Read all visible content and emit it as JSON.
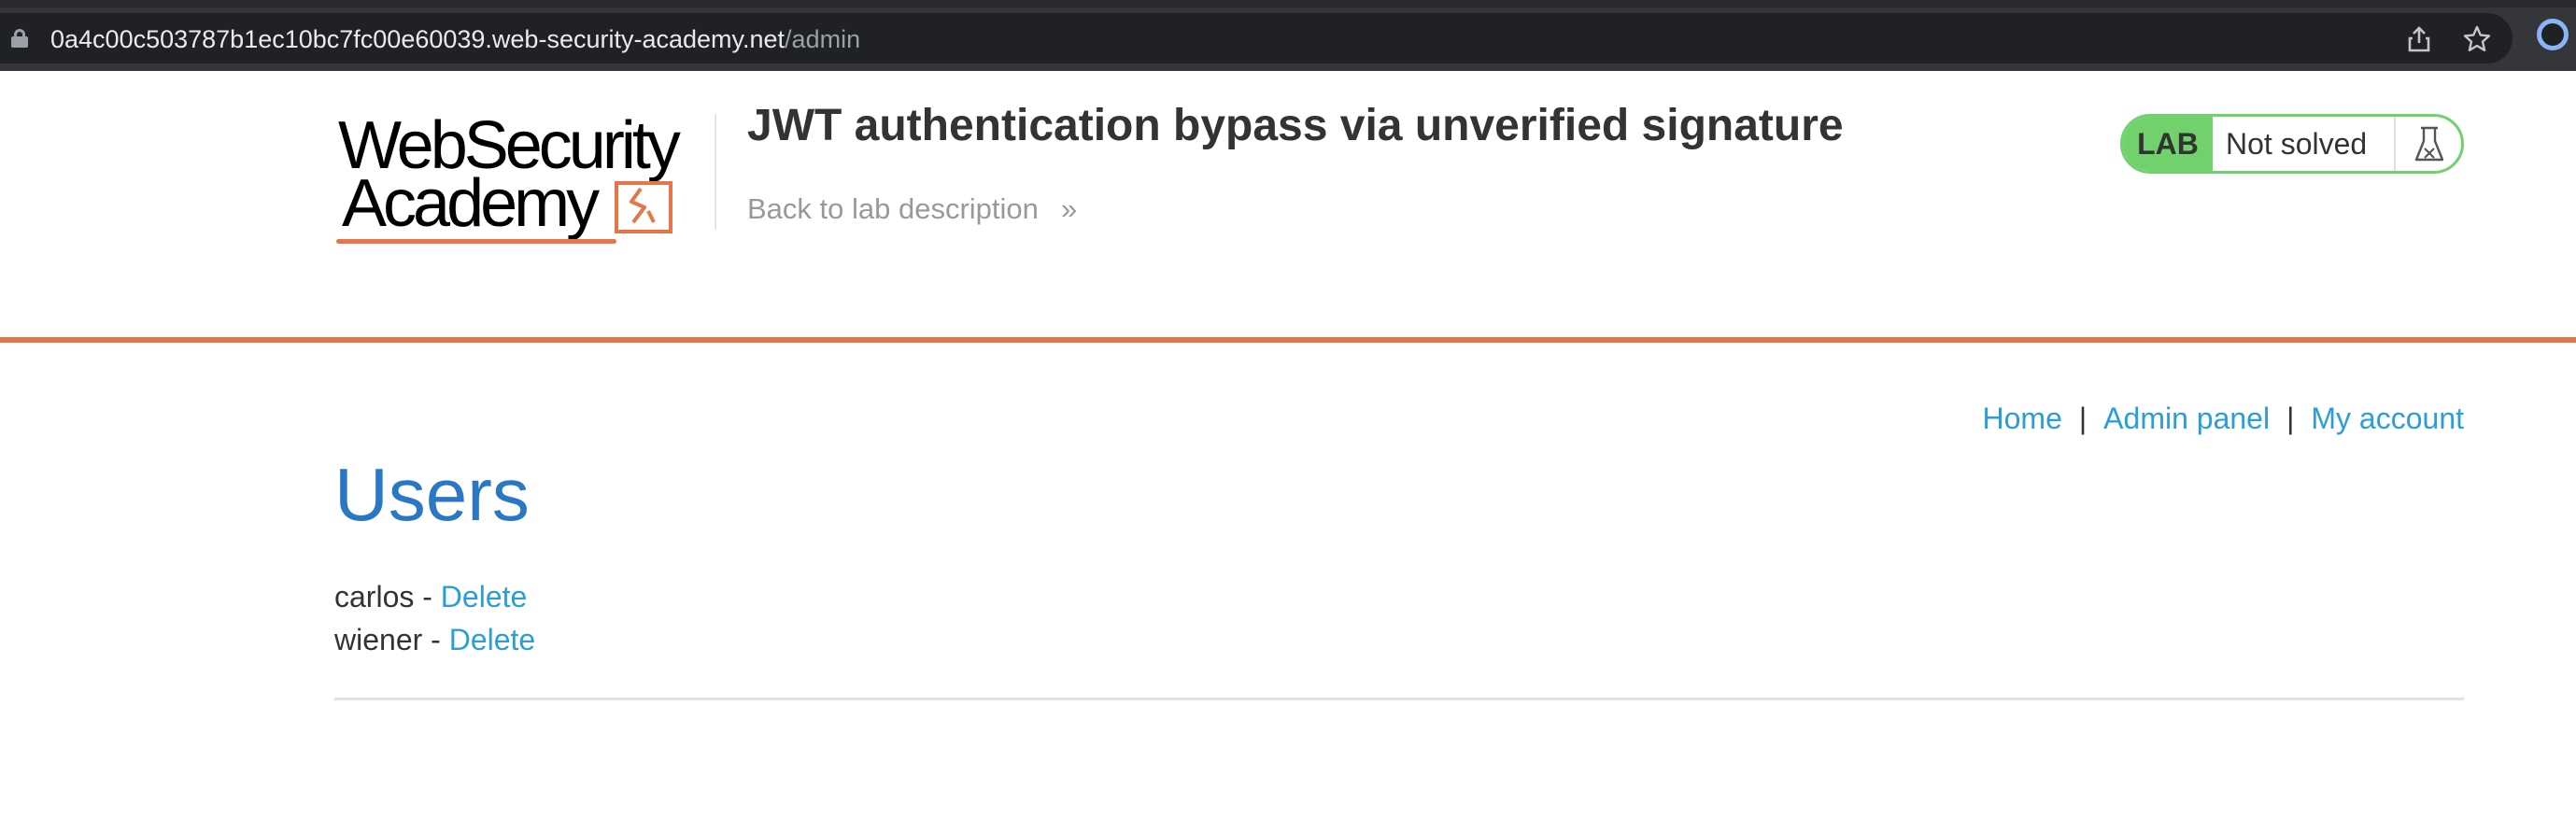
{
  "browser": {
    "url_host": "0a4c00c503787b1ec10bc7fc00e60039.web-security-academy.net",
    "url_path": "/admin",
    "icons": [
      "lock-icon",
      "share-icon",
      "star-icon",
      "profile-icon"
    ]
  },
  "header": {
    "logo_line1": "WebSecurity",
    "logo_line2": "Academy",
    "lab_title": "JWT authentication bypass via unverified signature",
    "back_link": "Back to lab description",
    "back_chevron": "»",
    "lab_badge": {
      "tag": "LAB",
      "status": "Not solved"
    }
  },
  "nav": {
    "home": "Home",
    "separator": "|",
    "admin_panel": "Admin panel",
    "my_account": "My account"
  },
  "main": {
    "heading": "Users",
    "users": [
      {
        "name": "carlos",
        "dash": " - ",
        "action": "Delete"
      },
      {
        "name": "wiener",
        "dash": " - ",
        "action": "Delete"
      }
    ]
  },
  "colors": {
    "accent_orange": "#e8744a",
    "link_blue": "#2b9ed8",
    "heading_blue": "#2a77c4",
    "lab_green": "#70d16d"
  }
}
